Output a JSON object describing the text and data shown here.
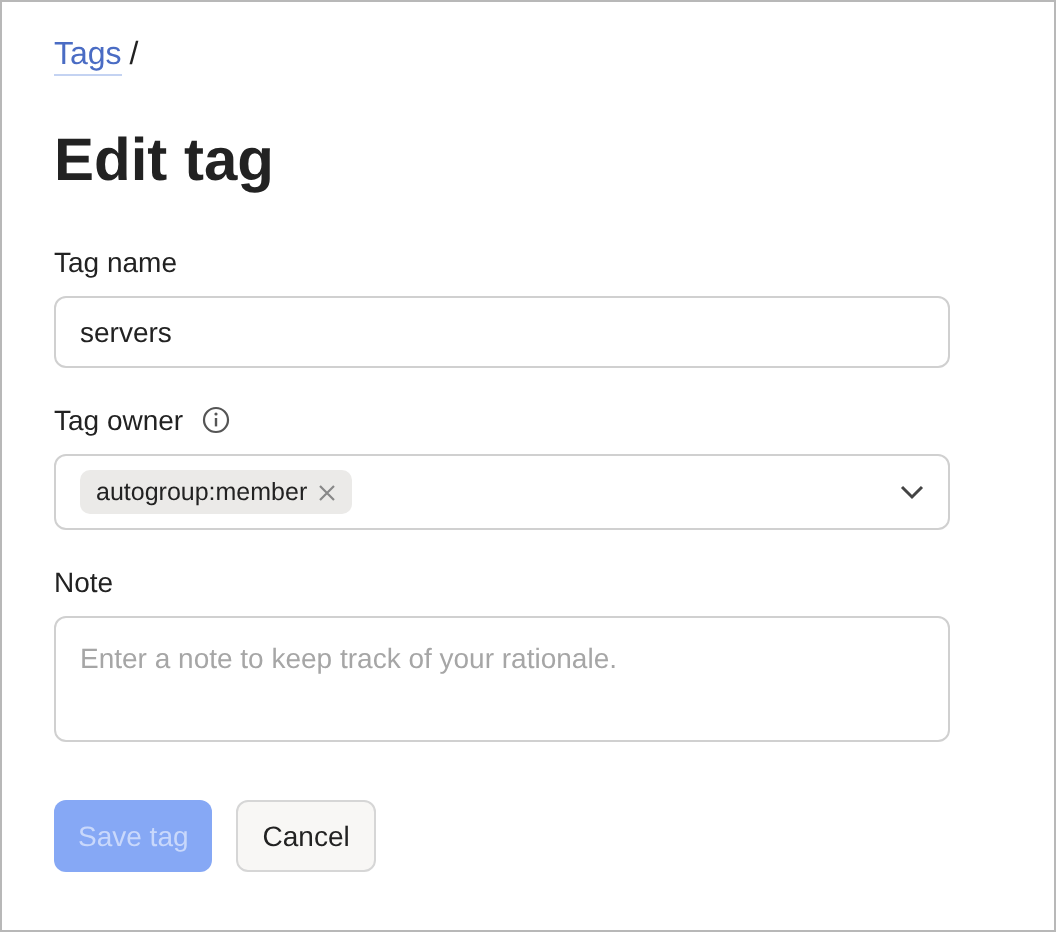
{
  "breadcrumb": {
    "link": "Tags",
    "separator": "/"
  },
  "title": "Edit tag",
  "fields": [
    {
      "kind": "text",
      "label": "Tag name",
      "value": "servers"
    },
    {
      "kind": "select",
      "label": "Tag owner",
      "info": true,
      "chips": [
        "autogroup:member"
      ]
    },
    {
      "kind": "textarea",
      "label": "Note",
      "placeholder": "Enter a note to keep track of your rationale."
    }
  ],
  "buttons": [
    {
      "label": "Save tag",
      "kind": "primary",
      "disabled": true
    },
    {
      "label": "Cancel",
      "kind": "secondary",
      "disabled": false
    }
  ]
}
